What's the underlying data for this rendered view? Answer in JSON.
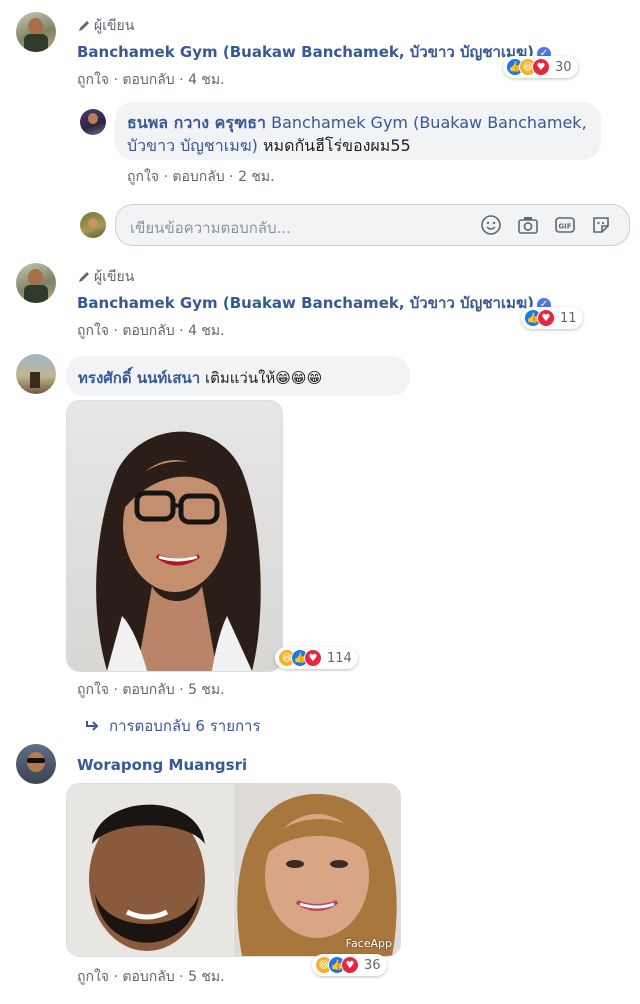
{
  "comments": [
    {
      "author_tag": "ผู้เขียน",
      "name": "Banchamek Gym (Buakaw Banchamek, บัวขาว บัญชาเมฆ)",
      "like": "ถูกใจ",
      "reply": "ตอบกลับ",
      "time": "4 ชม.",
      "reactions": "30"
    },
    {
      "name": "ธนพล กวาง ครุฑธา",
      "text_tag": "Banchamek Gym (Buakaw Banchamek, บัวขาว บัญชาเมฆ)",
      "text": "หมดกันฮีโร่ของผม55",
      "like": "ถูกใจ",
      "reply": "ตอบกลับ",
      "time": "2 ชม."
    },
    {
      "author_tag": "ผู้เขียน",
      "name": "Banchamek Gym (Buakaw Banchamek, บัวขาว บัญชาเมฆ)",
      "like": "ถูกใจ",
      "reply": "ตอบกลับ",
      "time": "4 ชม.",
      "reactions": "11"
    },
    {
      "name": "ทรงศักดิ์ นนท์เสนา",
      "text": "เติมแว่นให้",
      "emojis": "😁😁😁",
      "like": "ถูกใจ",
      "reply": "ตอบกลับ",
      "time": "5 ชม.",
      "reactions": "114",
      "replies_link": "การตอบกลับ 6 รายการ"
    },
    {
      "name": "Worapong Muangsri",
      "like": "ถูกใจ",
      "reply": "ตอบกลับ",
      "time": "5 ชม.",
      "reactions": "36",
      "watermark": "FaceApp"
    }
  ],
  "reply_box": {
    "placeholder": "เขียนข้อความตอบกลับ..."
  },
  "icons": [
    "pencil-icon",
    "verified-icon",
    "like-icon",
    "haha-icon",
    "love-icon",
    "smiley-icon",
    "camera-icon",
    "gif-icon",
    "sticker-icon",
    "reply-arrow-icon"
  ],
  "colors": {
    "link": "#385898",
    "meta": "#606770",
    "bubble": "#f2f3f5",
    "like": "#1877f2",
    "love": "#e8253d",
    "haha": "#f7b125"
  }
}
